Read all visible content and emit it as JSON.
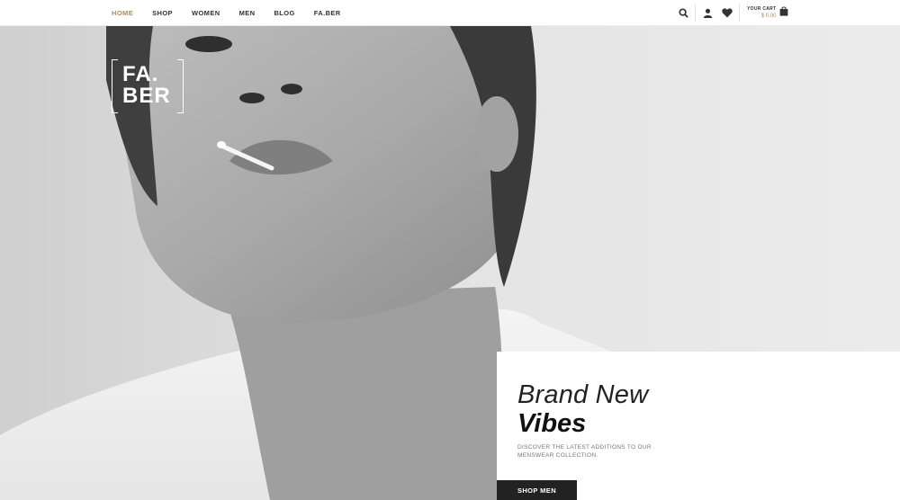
{
  "nav": {
    "items": [
      {
        "label": "HOME",
        "active": true
      },
      {
        "label": "SHOP",
        "active": false
      },
      {
        "label": "WOMEN",
        "active": false
      },
      {
        "label": "MEN",
        "active": false
      },
      {
        "label": "BLOG",
        "active": false
      },
      {
        "label": "FA.BER",
        "active": false
      }
    ],
    "active_color": "#b08a5a"
  },
  "header_icons": [
    "search-icon",
    "user-icon",
    "heart-icon",
    "shopping-bag-icon"
  ],
  "cart": {
    "label": "YOUR CART",
    "total": "$ 0.00"
  },
  "logo": {
    "line1": "FA.",
    "line2": "BER"
  },
  "hero": {
    "title_line1": "Brand New",
    "title_line2": "Vibes",
    "description": "DISCOVER THE LATEST ADDITIONS TO OUR MENSWEAR COLLECTION.",
    "button_label": "SHOP MEN"
  },
  "colors": {
    "accent": "#b08a5a",
    "button_bg": "#222222"
  }
}
